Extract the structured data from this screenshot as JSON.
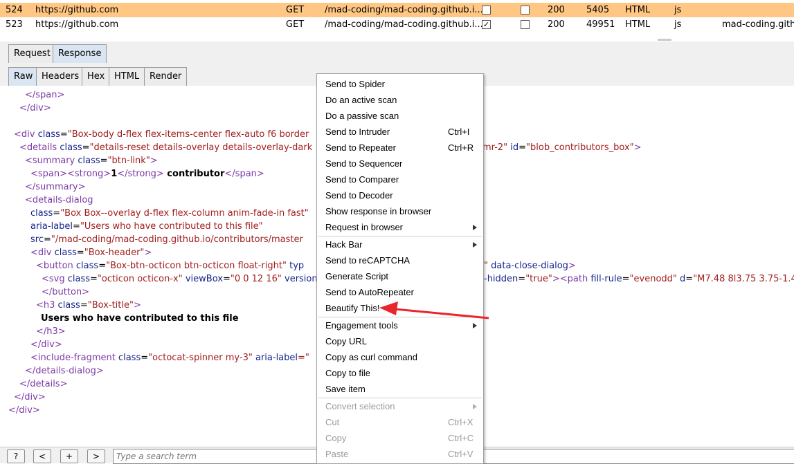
{
  "history": {
    "rows": [
      {
        "num": "524",
        "host": "https://github.com",
        "method": "GET",
        "url": "/mad-coding/mad-coding.github.i...",
        "params": false,
        "edited": false,
        "status": "200",
        "length": "5405",
        "mime": "HTML",
        "ext": "js",
        "title": "",
        "selected": true
      },
      {
        "num": "523",
        "host": "https://github.com",
        "method": "GET",
        "url": "/mad-coding/mad-coding.github.i...",
        "params": true,
        "edited": false,
        "status": "200",
        "length": "49951",
        "mime": "HTML",
        "ext": "js",
        "title": "mad-coding.github",
        "selected": false
      }
    ]
  },
  "tabs_top": [
    "Request",
    "Response"
  ],
  "tabs_sub": [
    "Raw",
    "Headers",
    "Hex",
    "HTML",
    "Render"
  ],
  "code": {
    "l01": "</span>",
    "l02": "</div>",
    "l03_open": "<div ",
    "l03_attr": "class",
    "l03_val": "\"Box-body d-flex flex-items-center flex-auto f6 border",
    "l04_open": "<details ",
    "l04_attr": "class",
    "l04_val": "\"details-reset details-overlay details-overlay-dark",
    "l04_tail_val": "mr-2\"",
    "l04_tail_attr": "id",
    "l04_tail_val2": "\"blob_contributors_box\"",
    "l04_close": ">",
    "l05_open": "<summary ",
    "l05_attr": "class",
    "l05_val": "\"btn-link\"",
    "l05_close": ">",
    "l06_a": "<span>",
    "l06_b": "<strong>",
    "l06_num": "1",
    "l06_c": "</strong>",
    "l06_text": " contributor",
    "l06_d": "</span>",
    "l07": "</summary>",
    "l08": "<details-dialog",
    "l09_attr": "class",
    "l09_val": "\"Box Box--overlay d-flex flex-column anim-fade-in fast\"",
    "l10_attr": "aria-label",
    "l10_val": "\"Users who have contributed to this file\"",
    "l11_attr": "src",
    "l11_val": "\"/mad-coding/mad-coding.github.io/contributors/master",
    "l12_open": "<div ",
    "l12_attr": "class",
    "l12_val": "\"Box-header\"",
    "l12_close": ">",
    "l13_open": "<button ",
    "l13_attr": "class",
    "l13_val": "\"Box-btn-octicon btn-octicon float-right\"",
    "l13_attr2": "typ",
    "l13_tail_val": "\"",
    "l13_tail_attr": "data-close-dialog",
    "l13_close": ">",
    "l14_open": "<svg ",
    "l14_attr": "class",
    "l14_val": "\"octicon octicon-x\"",
    "l14_attr2": "viewBox",
    "l14_val2": "\"0 0 12 16\"",
    "l14_attr3": "version",
    "l14_tail_attr": "-hidden",
    "l14_tail_val": "\"true\"",
    "l14_tail_tag": "><path ",
    "l14_tail_attr2": "fill-rule",
    "l14_tail_val2": "\"evenodd\"",
    "l14_tail_attr3": "d",
    "l14_tail_val3": "\"M7.48 8l3.75 3.75-1.4",
    "l15": "</button>",
    "l16_open": "<h3 ",
    "l16_attr": "class",
    "l16_val": "\"Box-title\"",
    "l16_close": ">",
    "l17": "Users who have contributed to this file",
    "l18": "</h3>",
    "l19": "</div>",
    "l20_open": "<include-fragment ",
    "l20_attr": "class",
    "l20_val": "\"octocat-spinner my-3\"",
    "l20_attr2": "aria-label",
    "l20_eq": "=\"",
    "l21": "</details-dialog>",
    "l22": "</details>",
    "l23": "</div>",
    "l24": "</div>"
  },
  "bottom": {
    "help": "?",
    "prev": "<",
    "add": "+",
    "next": ">",
    "search_placeholder": "Type a search term"
  },
  "menu": {
    "items": [
      {
        "label": "Send to Spider"
      },
      {
        "label": "Do an active scan"
      },
      {
        "label": "Do a passive scan"
      },
      {
        "label": "Send to Intruder",
        "shortcut": "Ctrl+I"
      },
      {
        "label": "Send to Repeater",
        "shortcut": "Ctrl+R"
      },
      {
        "label": "Send to Sequencer"
      },
      {
        "label": "Send to Comparer"
      },
      {
        "label": "Send to Decoder"
      },
      {
        "label": "Show response in browser"
      },
      {
        "label": "Request in browser",
        "submenu": true
      },
      {
        "label": "Hack Bar",
        "submenu": true
      },
      {
        "label": "Send to reCAPTCHA"
      },
      {
        "label": "Generate Script"
      },
      {
        "label": "Send to AutoRepeater"
      },
      {
        "label": "Beautify This!"
      },
      {
        "label": "Engagement tools",
        "submenu": true
      },
      {
        "label": "Copy URL"
      },
      {
        "label": "Copy as curl command"
      },
      {
        "label": "Copy to file"
      },
      {
        "label": "Save item"
      },
      {
        "label": "Convert selection",
        "submenu": true,
        "disabled": true
      },
      {
        "label": "Cut",
        "shortcut": "Ctrl+X",
        "disabled": true
      },
      {
        "label": "Copy",
        "shortcut": "Ctrl+C",
        "disabled": true
      },
      {
        "label": "Paste",
        "shortcut": "Ctrl+V",
        "disabled": true
      }
    ]
  },
  "colors": {
    "selected_row": "#ffc783",
    "arrow": "#e8262c",
    "tag": "#7c3aa7",
    "attr": "#15238a",
    "value": "#a21d1d"
  }
}
